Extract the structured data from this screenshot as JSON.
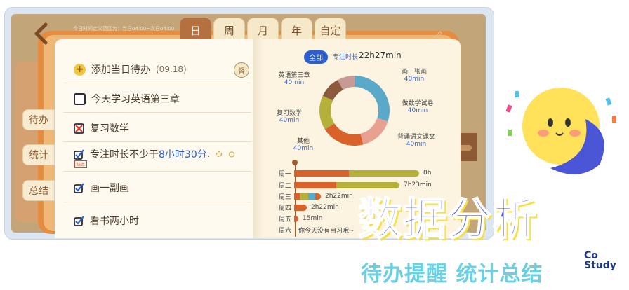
{
  "header": {
    "back_icon": "chevron-left-icon",
    "hint": "今日时间定义范围为：当日04:00~次日04:00",
    "tabs": [
      {
        "label": "日",
        "active": true
      },
      {
        "label": "周",
        "active": false
      },
      {
        "label": "月",
        "active": false
      },
      {
        "label": "年",
        "active": false
      },
      {
        "label": "自定",
        "active": false
      }
    ],
    "edit_icon": "pencil-icon"
  },
  "sidebar": {
    "items": [
      {
        "label": "待办"
      },
      {
        "label": "统计"
      },
      {
        "label": "总结"
      }
    ]
  },
  "todo": {
    "add_label": "添加当日待办",
    "add_date": "(09.18)",
    "circle_btn": "督",
    "items": [
      {
        "text": "今天学习英语第三章",
        "state": "empty"
      },
      {
        "text": "复习数学",
        "state": "failed"
      },
      {
        "prefix": "专注时长不少于",
        "highlight": "8小时30分",
        "suffix": ".",
        "state": "checked",
        "tag": "结束"
      },
      {
        "text": "画一副画",
        "state": "checked"
      },
      {
        "text": "看书两小时",
        "state": "checked"
      }
    ]
  },
  "stats": {
    "pill": "全部",
    "focus_label": "专注时长",
    "focus_total": "22h27min",
    "donut": [
      {
        "name": "画一张画",
        "value": "40min",
        "color": "#5aa9c9"
      },
      {
        "name": "做数学试卷",
        "value": "40min",
        "color": "#5aa9c9"
      },
      {
        "name": "背诵语文课文",
        "value": "40min",
        "color": "#e8a090"
      },
      {
        "name": "其他",
        "value": "40min",
        "color": "#d8622a"
      },
      {
        "name": "复习数学",
        "value": "40min",
        "color": "#b5b03a"
      },
      {
        "name": "英语第三章",
        "value": "40min",
        "color": "#8a5a3a"
      }
    ],
    "weekly": [
      {
        "day": "周一",
        "label": "8h",
        "segments": [
          {
            "w": 78,
            "c": "#d8622a"
          },
          {
            "w": 100,
            "c": "#b5b03a"
          }
        ]
      },
      {
        "day": "周二",
        "label": "7h23min",
        "segments": [
          {
            "w": 60,
            "c": "#d8622a"
          },
          {
            "w": 90,
            "c": "#b5b03a"
          }
        ]
      },
      {
        "day": "周三",
        "label": "2h22min",
        "segments": [
          {
            "w": 8,
            "c": "#d8622a"
          },
          {
            "w": 12,
            "c": "#b5b03a"
          },
          {
            "w": 10,
            "c": "#5aa9c9"
          },
          {
            "w": 8,
            "c": "#d8622a"
          }
        ]
      },
      {
        "day": "周四",
        "label": "2h22min",
        "segments": [
          {
            "w": 18,
            "c": "#d8622a"
          }
        ]
      },
      {
        "day": "周五",
        "label": "15min",
        "segments": [
          {
            "w": 6,
            "c": "#d8622a"
          }
        ]
      },
      {
        "day": "周六",
        "label": "你今天没有自习哦~",
        "segments": []
      }
    ]
  },
  "promo": {
    "title": "数据分析",
    "subtitle": "待办提醒 统计总结",
    "logo_line1": "Co",
    "logo_line2": "Study"
  }
}
